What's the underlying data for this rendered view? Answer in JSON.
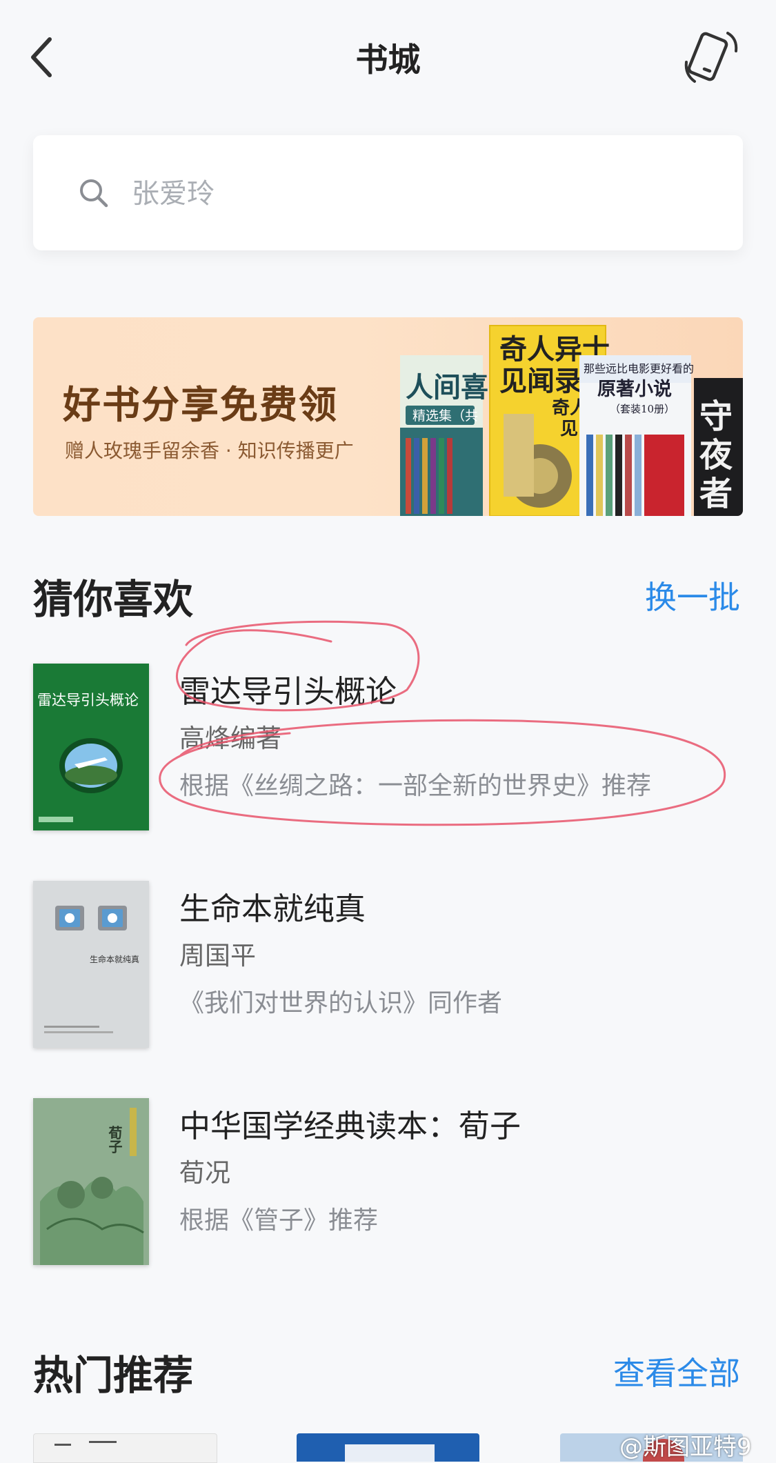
{
  "nav": {
    "title": "书城"
  },
  "search": {
    "placeholder": "张爱玲"
  },
  "banner": {
    "title": "好书分享免费领",
    "subtitle": "赠人玫瑰手留余香 · 知识传播更广",
    "book_texts": [
      "人间喜",
      "精选集（共",
      "奇人异士",
      "见闻录",
      "奇人",
      "见",
      "那些远比电影更好看的",
      "原著小说",
      "（套装10册）",
      "守",
      "夜",
      "者"
    ]
  },
  "recommend": {
    "title": "猜你喜欢",
    "action": "换一批",
    "items": [
      {
        "title": "雷达导引头概论",
        "author": "高烽编著",
        "reason": "根据《丝绸之路：一部全新的世界史》推荐",
        "cover_text": "雷达导引头概论",
        "cover_bg": "#1a7a36"
      },
      {
        "title": "生命本就纯真",
        "author": "周国平",
        "reason": "《我们对世界的认识》同作者",
        "cover_text": "生命本就纯真",
        "cover_bg": "#d7dadc"
      },
      {
        "title": "中华国学经典读本：荀子",
        "author": "荀况",
        "reason": "根据《管子》推荐",
        "cover_text": "荀子",
        "cover_bg": "#8fae90"
      }
    ]
  },
  "hot": {
    "title": "热门推荐",
    "action": "查看全部"
  },
  "watermark": "@斯图亚特9",
  "colors": {
    "accent": "#2b8ae8",
    "background": "#f7f8fa",
    "banner_bg": "#fde1c7",
    "annotation": "#e8536a"
  }
}
